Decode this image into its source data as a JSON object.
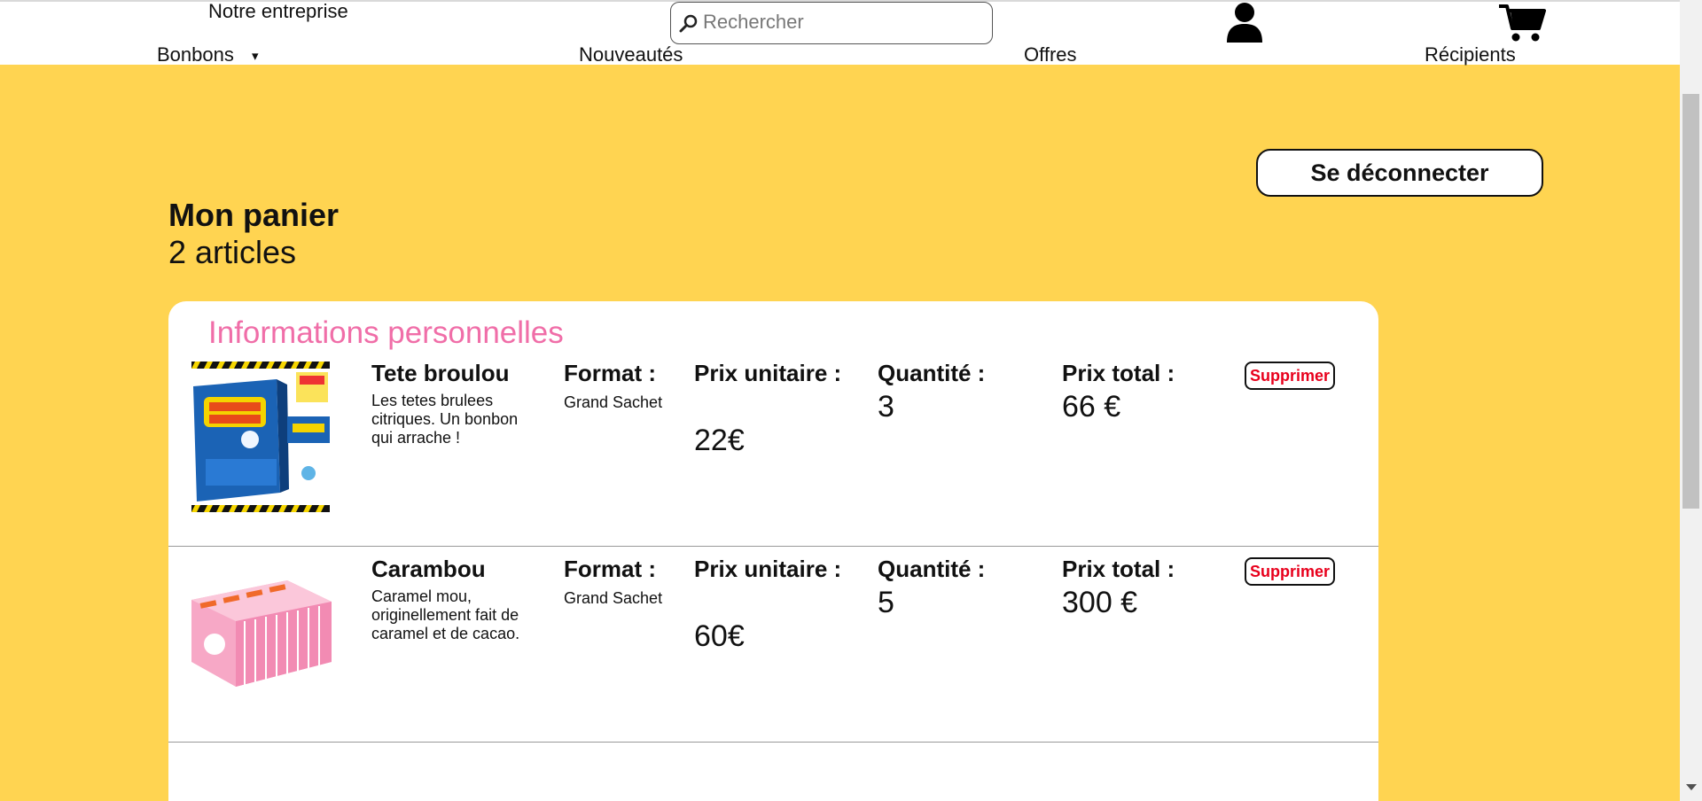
{
  "header": {
    "company": "Notre entreprise",
    "search_placeholder": "Rechercher",
    "nav": {
      "bonbons": "Bonbons",
      "caret": "▾",
      "nouveautes": "Nouveautés",
      "offres": "Offres",
      "recipients": "Récipients"
    },
    "icons": {
      "search": "search-icon",
      "user": "user-icon",
      "cart": "cart-icon"
    }
  },
  "account": {
    "logout_label": "Se déconnecter"
  },
  "cart": {
    "title": "Mon panier",
    "count": "2 articles",
    "section_title": "Informations personnelles",
    "labels": {
      "format": "Format :",
      "unit_price": "Prix unitaire :",
      "quantity": "Quantité :",
      "total": "Prix total :",
      "delete": "Supprimer"
    },
    "items": [
      {
        "name": "Tete broulou",
        "description": "Les tetes brulees citriques. Un bonbon qui arrache !",
        "format": "Grand Sachet",
        "unit_price": "22€",
        "quantity": "3",
        "total": "66 €"
      },
      {
        "name": "Carambou",
        "description": "Caramel mou, originellement fait de caramel et de cacao.",
        "format": "Grand Sachet",
        "unit_price": "60€",
        "quantity": "5",
        "total": "300 €"
      }
    ]
  },
  "colors": {
    "background": "#ffd451",
    "section_title": "#f06ea8",
    "delete_text": "#e8001c"
  }
}
